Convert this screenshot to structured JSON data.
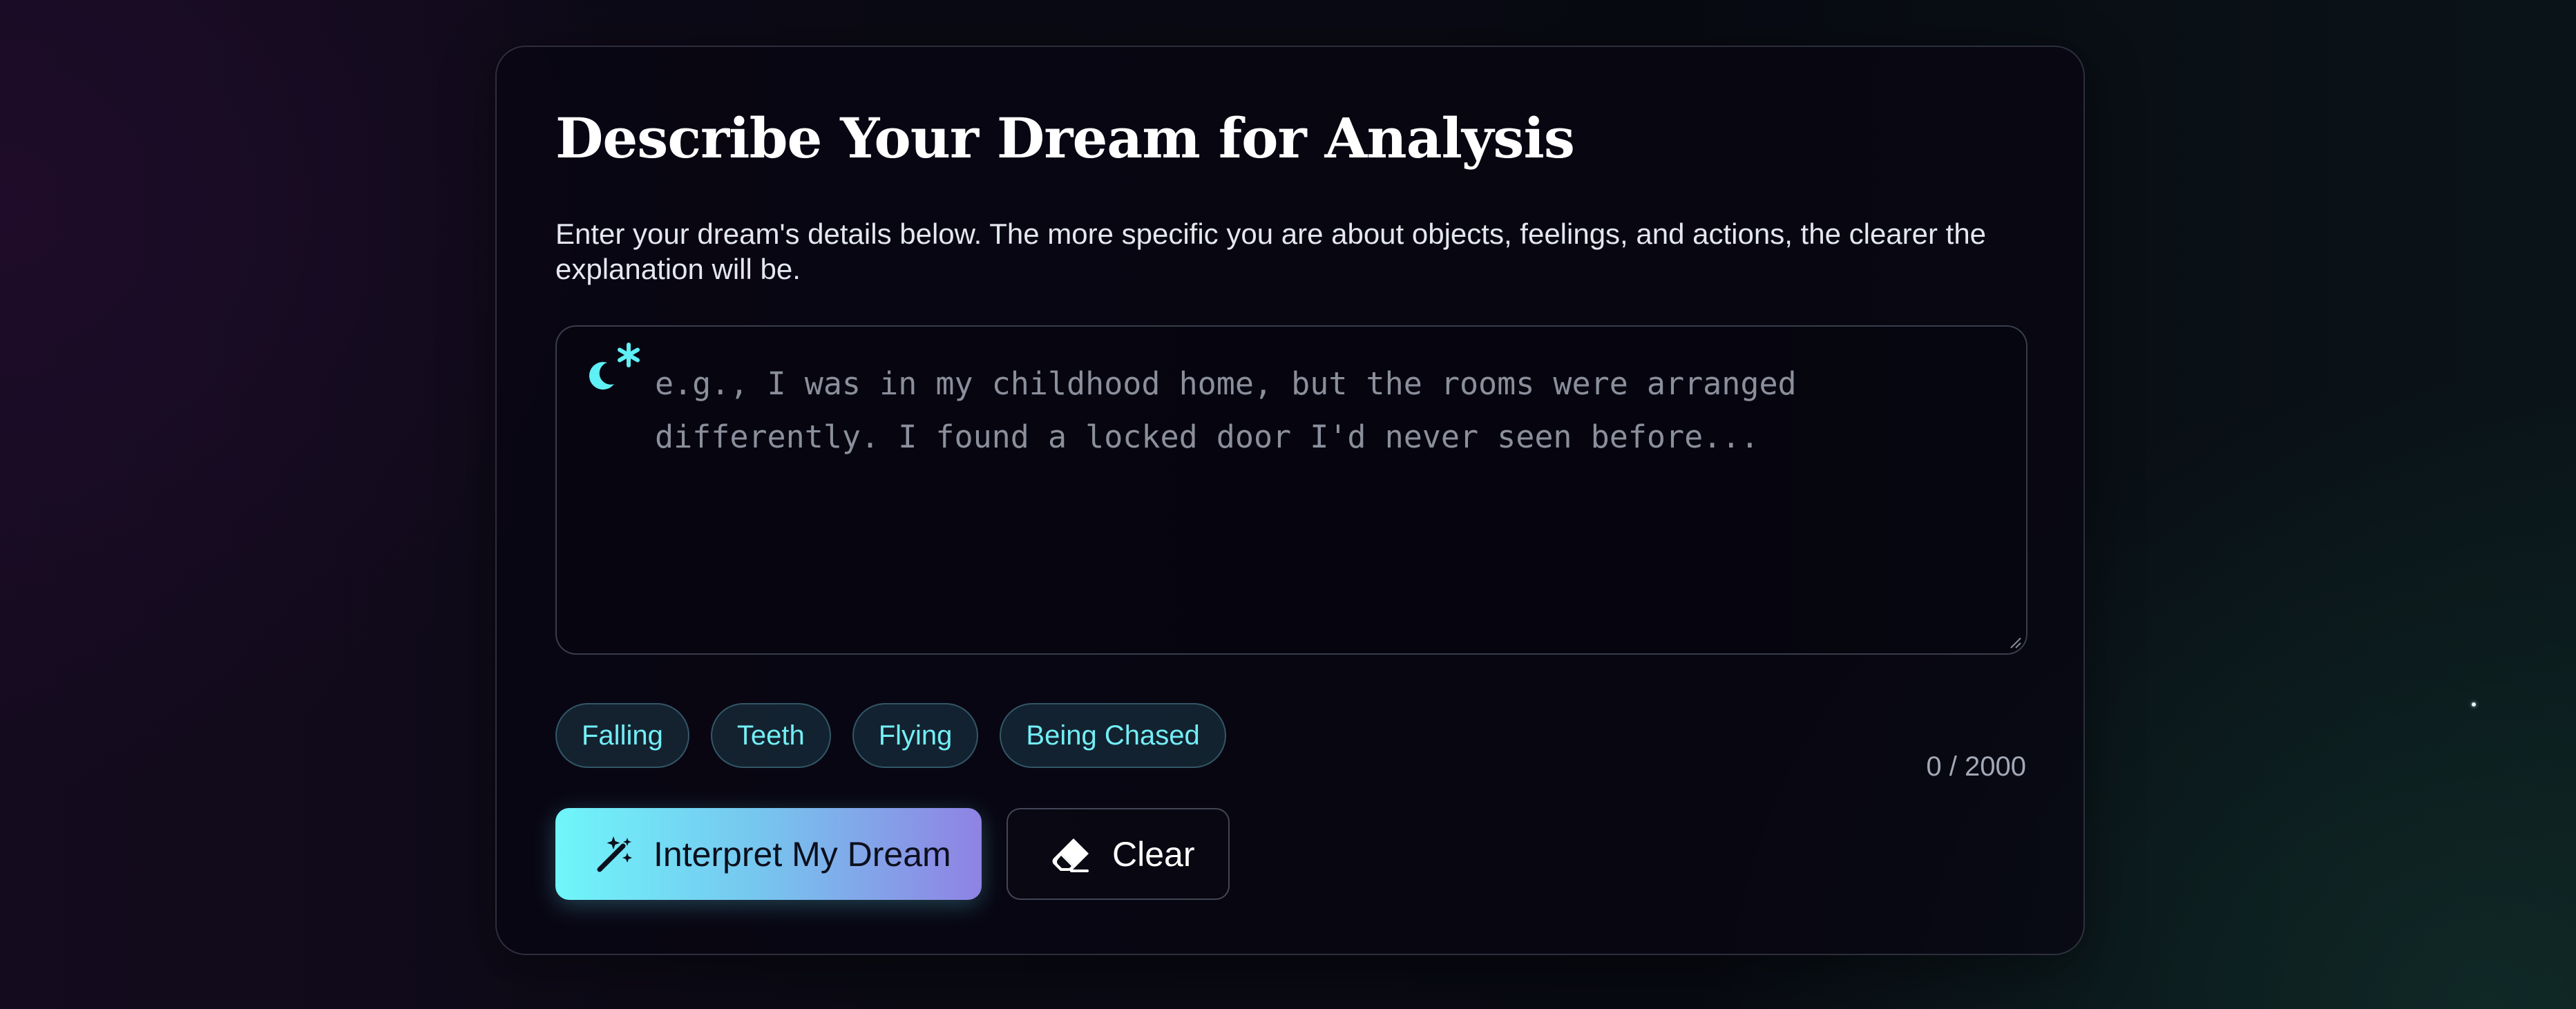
{
  "form": {
    "title": "Describe Your Dream for Analysis",
    "subtitle": "Enter your dream's details below. The more specific you are about objects, feelings, and actions, the clearer the explanation will be.",
    "input": {
      "value": "",
      "placeholder": "e.g., I was in my childhood home, but the rooms were arranged differently. I found a locked door I'd never seen before...",
      "icon": "moon-star-icon"
    },
    "tags": [
      {
        "label": "Falling"
      },
      {
        "label": "Teeth"
      },
      {
        "label": "Flying"
      },
      {
        "label": "Being Chased"
      }
    ],
    "counter": "0 / 2000",
    "buttons": {
      "interpret": {
        "label": "Interpret My Dream",
        "icon": "magic-wand-icon"
      },
      "clear": {
        "label": "Clear",
        "icon": "eraser-icon"
      }
    }
  },
  "colors": {
    "accent_cyan": "#73eef5",
    "gradient_start": "#6ff6fa",
    "gradient_end": "#8f82e3",
    "card_background": "#0a0814",
    "page_background": "#0a0a14"
  }
}
